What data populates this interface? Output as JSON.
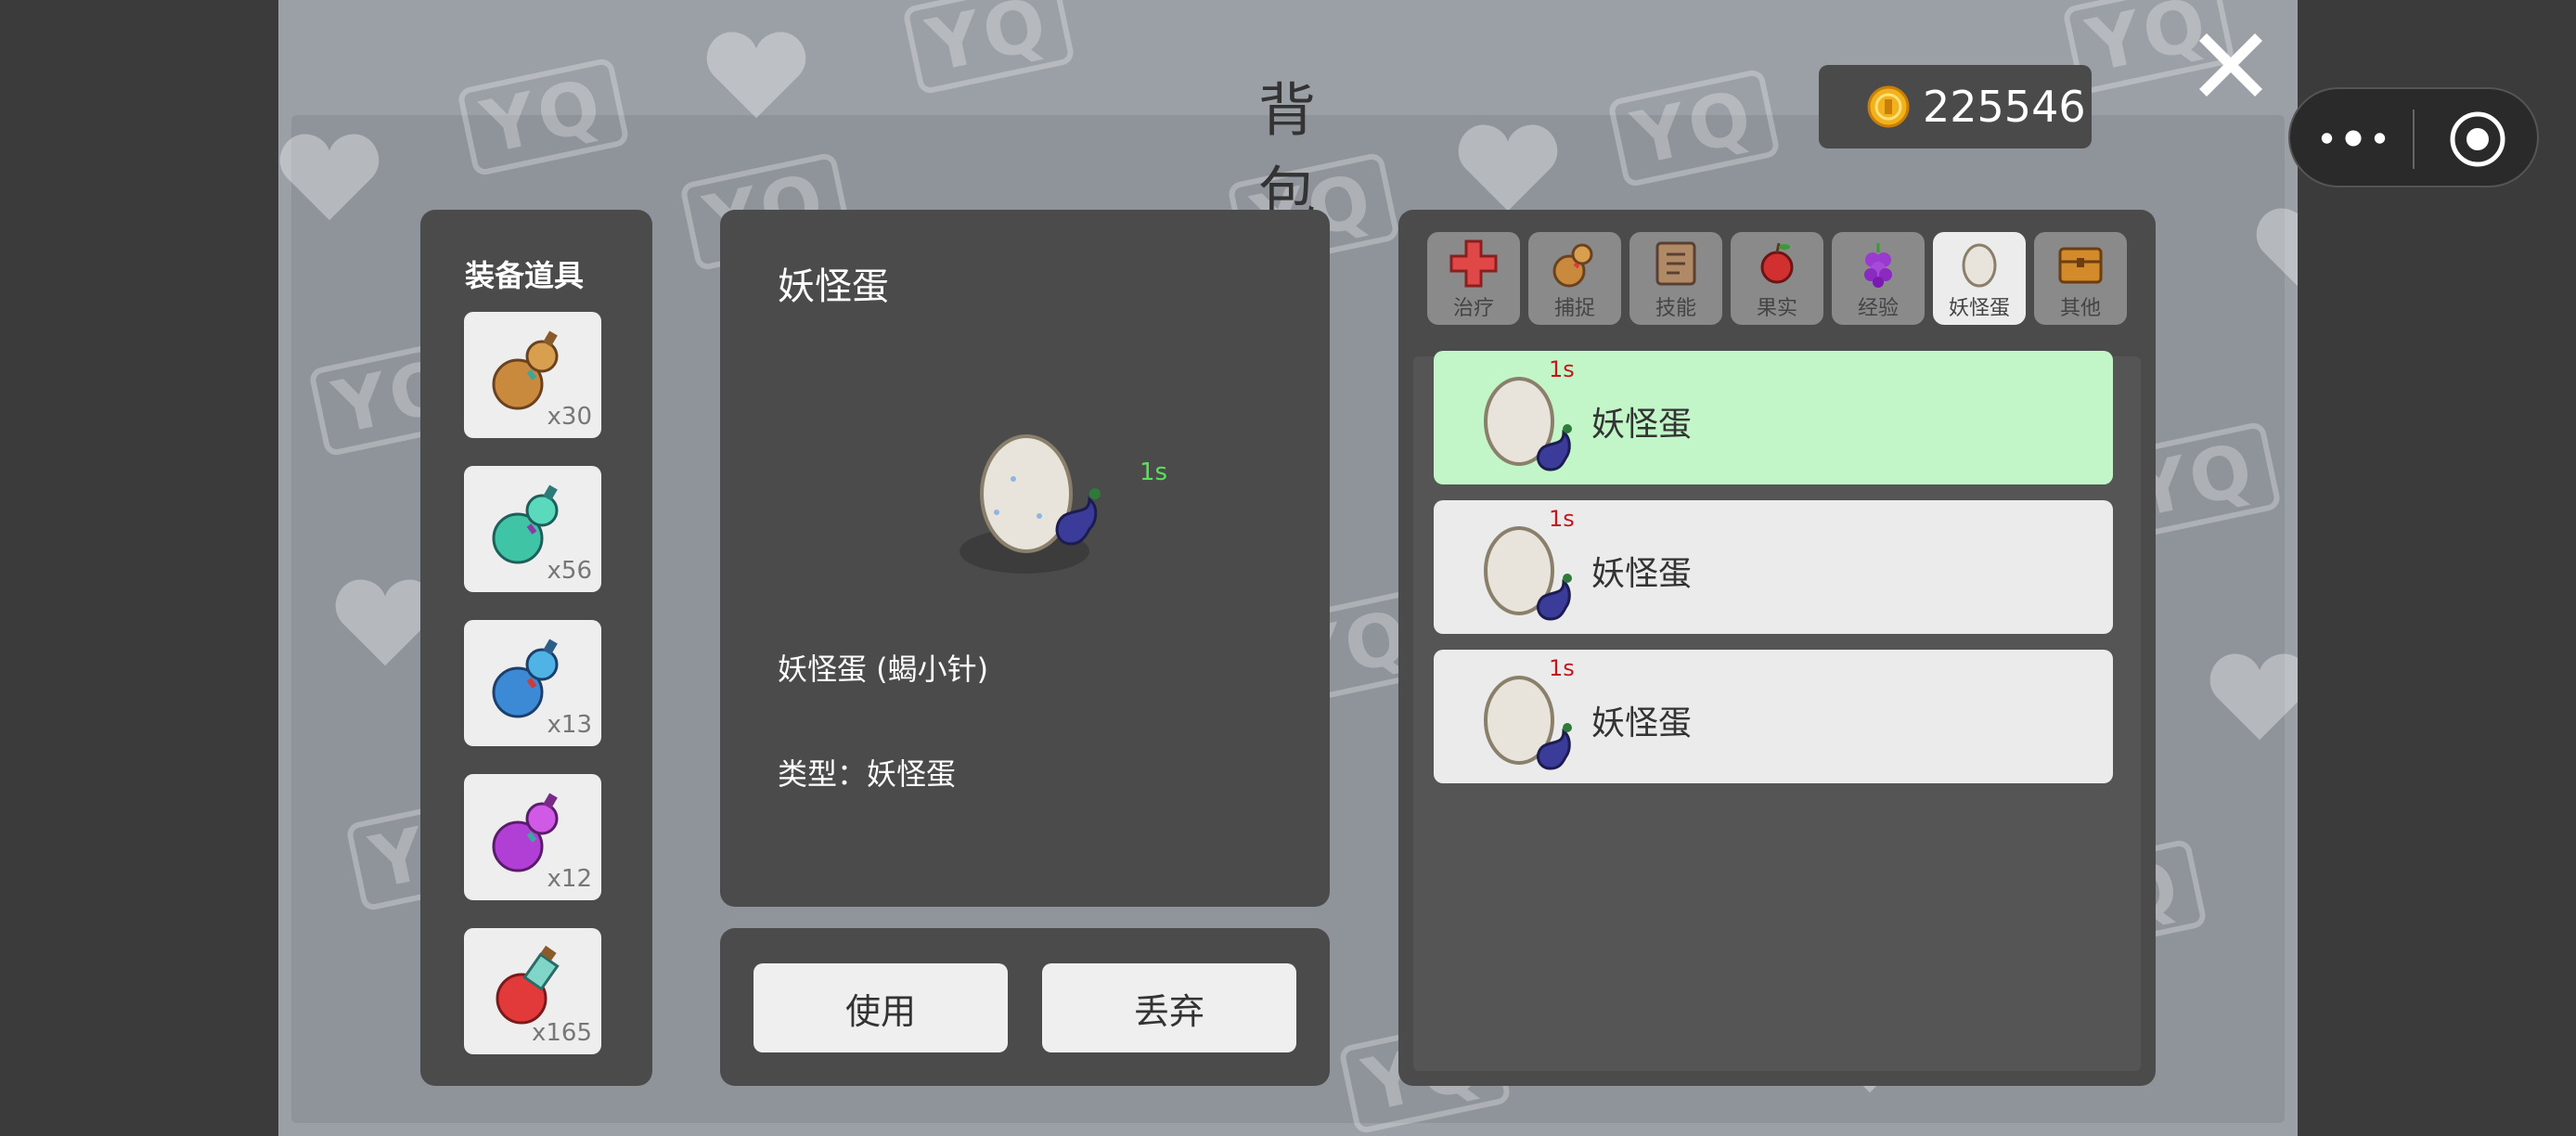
{
  "header": {
    "title": "背包"
  },
  "currency": {
    "amount": "225546",
    "coin_color": "#f2b21b"
  },
  "equipment": {
    "title": "装备道具",
    "slots": [
      {
        "icon": "gold-gourd-icon",
        "count": "x30"
      },
      {
        "icon": "teal-gourd-icon",
        "count": "x56"
      },
      {
        "icon": "blue-gourd-icon",
        "count": "x13"
      },
      {
        "icon": "purple-gourd-icon",
        "count": "x12"
      },
      {
        "icon": "red-potion-icon",
        "count": "x165"
      }
    ]
  },
  "detail": {
    "title": "妖怪蛋",
    "timer": "1s",
    "name": "妖怪蛋 (蝎小针)",
    "type_line": "类型：妖怪蛋"
  },
  "actions": {
    "use_label": "使用",
    "discard_label": "丢弃"
  },
  "categories": [
    {
      "label": "治疗",
      "icon": "red-cross-icon",
      "active": false
    },
    {
      "label": "捕捉",
      "icon": "gourd-icon",
      "active": false
    },
    {
      "label": "技能",
      "icon": "skill-scroll-icon",
      "active": false
    },
    {
      "label": "果实",
      "icon": "apple-icon",
      "active": false
    },
    {
      "label": "经验",
      "icon": "grape-icon",
      "active": false
    },
    {
      "label": "妖怪蛋",
      "icon": "egg-icon",
      "active": true
    },
    {
      "label": "其他",
      "icon": "chest-icon",
      "active": false
    }
  ],
  "bag_items": [
    {
      "name": "妖怪蛋",
      "timer": "1s",
      "selected": true
    },
    {
      "name": "妖怪蛋",
      "timer": "1s",
      "selected": false
    },
    {
      "name": "妖怪蛋",
      "timer": "1s",
      "selected": false
    }
  ],
  "colors": {
    "selected_row": "#c2f5c8",
    "timer_red": "#c0181d",
    "timer_green": "#5be05b"
  },
  "watermark": "YQ"
}
